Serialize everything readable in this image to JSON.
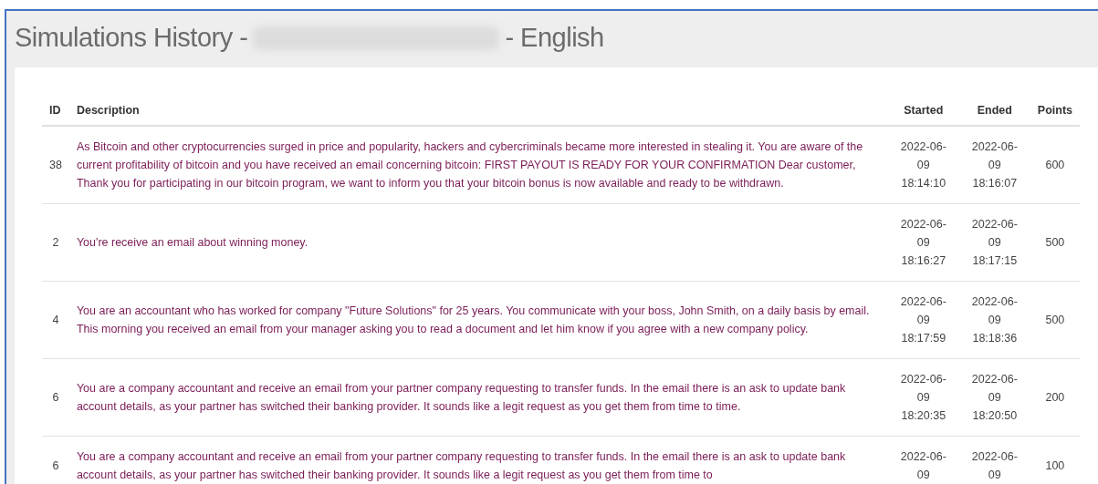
{
  "page": {
    "title_prefix": "Simulations History -",
    "title_suffix": "- English"
  },
  "table": {
    "columns": [
      "ID",
      "Description",
      "Started",
      "Ended",
      "Points"
    ],
    "rows": [
      {
        "id": "38",
        "description": "As Bitcoin and other cryptocurrencies surged in price and popularity, hackers and cybercriminals became more interested in stealing it. You are aware of the current profitability of bitcoin and you have received an email concerning bitcoin: FIRST PAYOUT IS READY FOR YOUR CONFIRMATION Dear customer, Thank you for participating in our bitcoin program, we want to inform you that your bitcoin bonus is now available and ready to be withdrawn.",
        "started": "2022-06-09 18:14:10",
        "ended": "2022-06-09 18:16:07",
        "points": "600"
      },
      {
        "id": "2",
        "description": "You're receive an email about winning money.",
        "started": "2022-06-09 18:16:27",
        "ended": "2022-06-09 18:17:15",
        "points": "500"
      },
      {
        "id": "4",
        "description": "You are an accountant who has worked for company \"Future Solutions\" for 25 years. You communicate with your boss, John Smith, on a daily basis by email. This morning you received an email from your manager asking you to read a document and let him know if you agree with a new company policy.",
        "started": "2022-06-09 18:17:59",
        "ended": "2022-06-09 18:18:36",
        "points": "500"
      },
      {
        "id": "6",
        "description": "You are a company accountant and receive an email from your partner company requesting to transfer funds. In the email there is an ask to update bank account details, as your partner has switched their banking provider. It sounds like a legit request as you get them from time to time.",
        "started": "2022-06-09 18:20:35",
        "ended": "2022-06-09 18:20:50",
        "points": "200"
      },
      {
        "id": "6",
        "description": "You are a company accountant and receive an email from your partner company requesting to transfer funds. In the email there is an ask to update bank account details, as your partner has switched their banking provider. It sounds like a legit request as you get them from time to",
        "started": "2022-06-09",
        "ended": "2022-06-09",
        "points": "100"
      }
    ]
  }
}
